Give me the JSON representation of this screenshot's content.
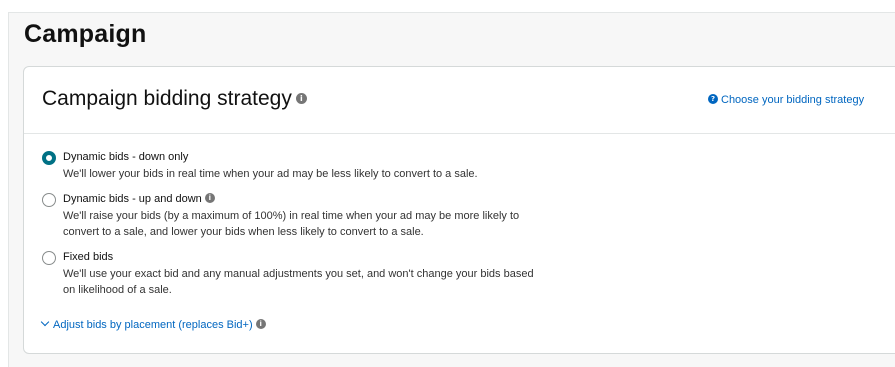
{
  "page": {
    "title": "Campaign"
  },
  "card": {
    "title": "Campaign bidding strategy",
    "help_link": "Choose your bidding strategy"
  },
  "options": [
    {
      "label": "Dynamic bids - down only",
      "checked": true,
      "desc_lines": [
        "We'll lower your bids in real time when your ad may be less likely to convert to a sale."
      ]
    },
    {
      "label": "Dynamic bids - up and down",
      "checked": false,
      "desc_lines": [
        "We'll raise your bids (by a maximum of 100%) in real time when your ad may be more likely to",
        "convert to a sale, and lower your bids when less likely to convert to a sale."
      ]
    },
    {
      "label": "Fixed bids",
      "checked": false,
      "desc_lines": [
        "We'll use your exact bid and any manual adjustments you set, and won't change your bids based",
        "on likelihood of a sale."
      ]
    }
  ],
  "adjust_link": "Adjust bids by placement (replaces Bid+)",
  "colors": {
    "accent": "#007185",
    "link": "#0066c0"
  },
  "icons": {
    "info": "info-circle-icon",
    "help": "question-circle-icon",
    "chevron": "chevron-down-icon"
  }
}
